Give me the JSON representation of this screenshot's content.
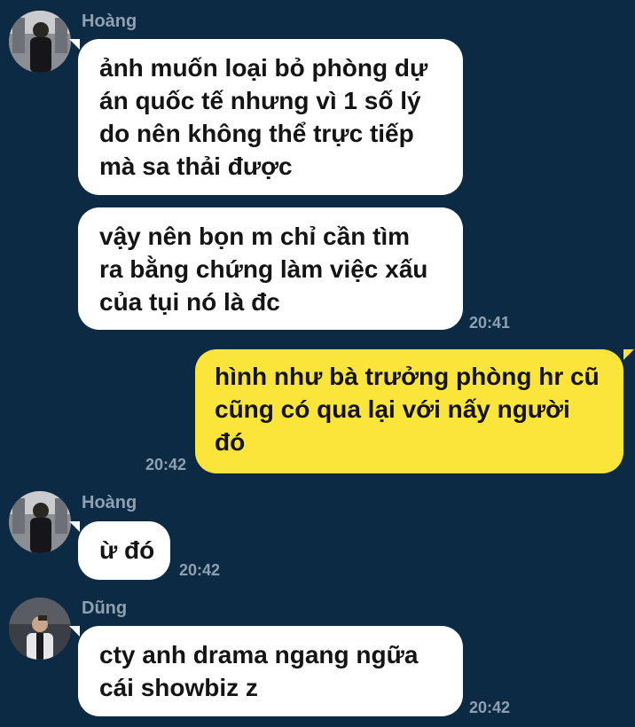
{
  "colors": {
    "background": "#0c2a43",
    "incoming_bubble": "#ffffff",
    "outgoing_bubble": "#fbe53a",
    "meta_text": "#8fa0b2"
  },
  "groups": [
    {
      "sender": "Hoàng",
      "avatar_icon": "avatar-photo",
      "messages": [
        {
          "lines": [
            "ảnh muốn loại bỏ phòng dự",
            "án quốc tế nhưng vì 1 số lý",
            "do nên không thể trực tiếp",
            "mà sa thải được"
          ]
        },
        {
          "lines": [
            "vậy nên bọn m chỉ cần tìm",
            "ra bằng chứng làm việc xấu",
            "của tụi nó là đc"
          ],
          "time": "20:41"
        }
      ]
    },
    {
      "sender": "me",
      "messages": [
        {
          "lines": [
            "hình như bà trưởng phòng hr cũ",
            "cũng có qua lại với nấy người",
            "đó"
          ],
          "time": "20:42"
        }
      ]
    },
    {
      "sender": "Hoàng",
      "avatar_icon": "avatar-photo",
      "messages": [
        {
          "lines": [
            "ừ đó"
          ],
          "time": "20:42"
        }
      ]
    },
    {
      "sender": "Dũng",
      "avatar_icon": "avatar-photo",
      "messages": [
        {
          "lines": [
            "cty anh drama ngang ngữa",
            "cái showbiz z"
          ],
          "time": "20:42"
        }
      ]
    }
  ]
}
